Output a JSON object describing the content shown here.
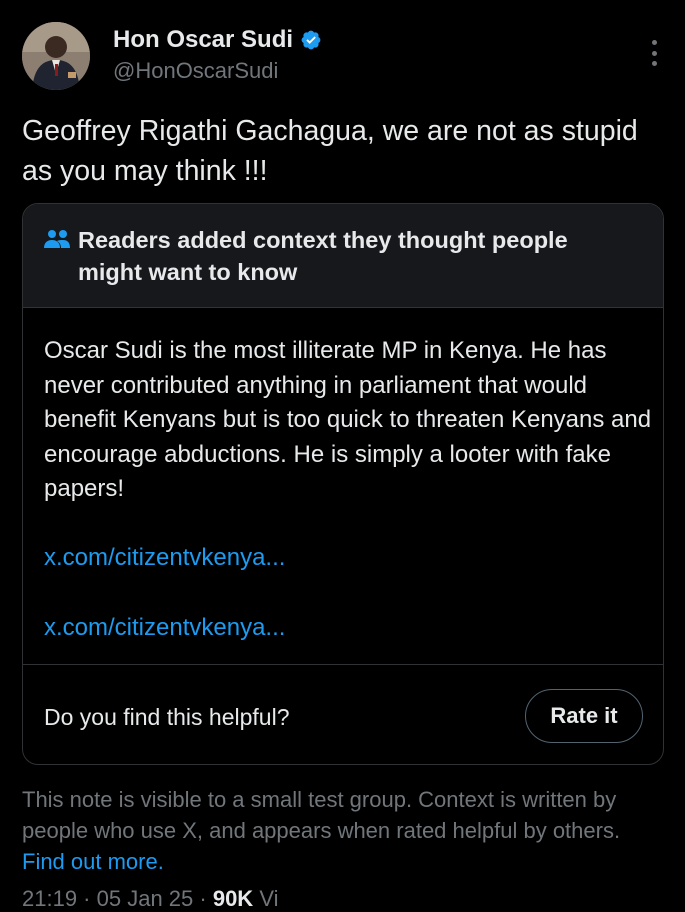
{
  "author": {
    "name": "Hon Oscar Sudi",
    "handle": "@HonOscarSudi",
    "verified": true
  },
  "tweet": {
    "text": "Geoffrey Rigathi Gachagua, we are not as stupid as you may think !!!"
  },
  "community_note": {
    "header": "Readers added context they thought people might want to know",
    "body": "Oscar Sudi is the most illiterate MP in Kenya. He has never contributed anything in parliament that would benefit Kenyans but is too quick to threaten Kenyans and encourage abductions. He is simply a looter with fake papers!",
    "links": [
      "x.com/citizentvkenya...",
      "x.com/citizentvkenya..."
    ],
    "helpful_question": "Do you find this helpful?",
    "rate_button": "Rate it"
  },
  "footer": {
    "text": "This note is visible to a small test group. Context is written by people who use X, and appears when rated helpful by others.",
    "link": "Find out more."
  },
  "meta": {
    "time": "21:19",
    "date": "05 Jan 25",
    "views": "90K",
    "views_label": "Vi"
  },
  "colors": {
    "background": "#000000",
    "accent": "#1d9bf0",
    "secondary_text": "#71767b",
    "verified_badge": "#1d9bf0"
  }
}
